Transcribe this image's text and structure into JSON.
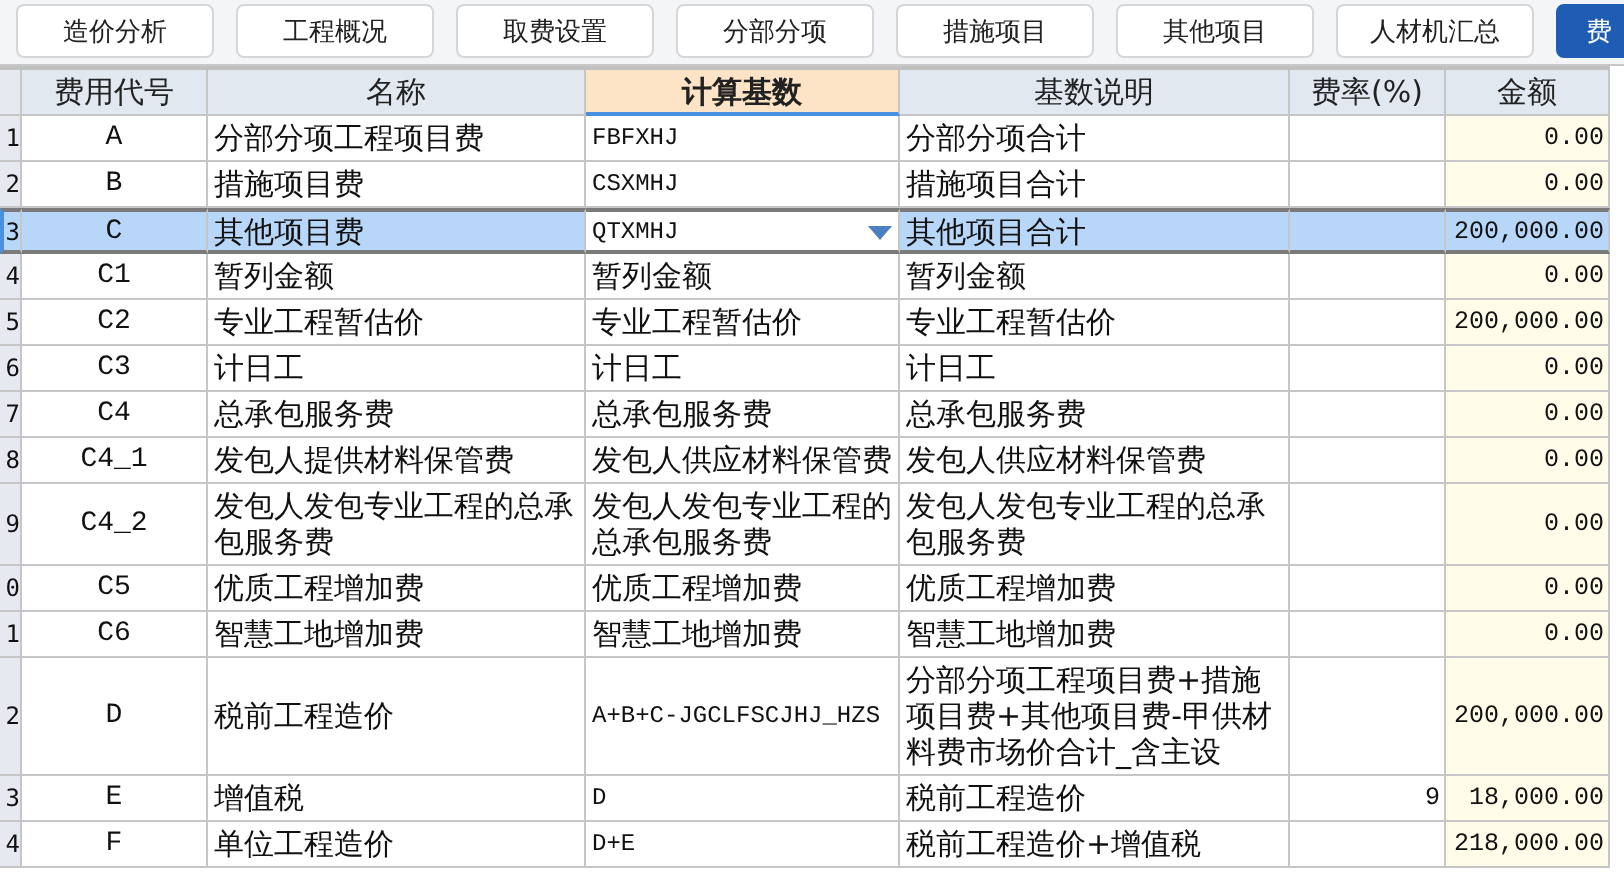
{
  "toolbar": {
    "buttons": [
      {
        "label": "造价分析",
        "selected": false
      },
      {
        "label": "工程概况",
        "selected": false
      },
      {
        "label": "取费设置",
        "selected": false
      },
      {
        "label": "分部分项",
        "selected": false
      },
      {
        "label": "措施项目",
        "selected": false
      },
      {
        "label": "其他项目",
        "selected": false
      },
      {
        "label": "人材机汇总",
        "selected": false
      },
      {
        "label": "费",
        "selected": true
      }
    ]
  },
  "table": {
    "columns": [
      {
        "label": "费用代号",
        "highlighted": false
      },
      {
        "label": "名称",
        "highlighted": false
      },
      {
        "label": "计算基数",
        "highlighted": true
      },
      {
        "label": "基数说明",
        "highlighted": false
      },
      {
        "label": "费率(%)",
        "highlighted": false
      },
      {
        "label": "金额",
        "highlighted": false
      }
    ],
    "rows": [
      {
        "row_number": "1",
        "code": "A",
        "name": "分部分项工程项目费",
        "basis": "FBFXHJ",
        "description": "分部分项合计",
        "amount": "0.00",
        "selected": false
      },
      {
        "row_number": "2",
        "code": "B",
        "name": "措施项目费",
        "basis": "CSXMHJ",
        "description": "措施项目合计",
        "amount": "0.00",
        "selected": false
      },
      {
        "row_number": "3",
        "code": "C",
        "name": "其他项目费",
        "basis": "QTXMHJ",
        "description": "其他项目合计",
        "amount": "200,000.00",
        "selected": true
      },
      {
        "row_number": "4",
        "code": "C1",
        "name": "暂列金额",
        "basis": "暂列金额",
        "description": "暂列金额",
        "amount": "0.00",
        "selected": false
      },
      {
        "row_number": "5",
        "code": "C2",
        "name": "专业工程暂估价",
        "basis": "专业工程暂估价",
        "description": "专业工程暂估价",
        "amount": "200,000.00",
        "selected": false
      },
      {
        "row_number": "6",
        "code": "C3",
        "name": "计日工",
        "basis": "计日工",
        "description": "计日工",
        "amount": "0.00",
        "selected": false
      },
      {
        "row_number": "7",
        "code": "C4",
        "name": "总承包服务费",
        "basis": "总承包服务费",
        "description": "总承包服务费",
        "amount": "0.00",
        "selected": false
      },
      {
        "row_number": "8",
        "code": "C4_1",
        "name": "发包人提供材料保管费",
        "basis": "发包人供应材料保管费",
        "description": "发包人供应材料保管费",
        "amount": "0.00",
        "selected": false
      },
      {
        "row_number": "9",
        "code": "C4_2",
        "name": "发包人发包专业工程的总承包服务费",
        "basis": "发包人发包专业工程的总承包服务费",
        "description": "发包人发包专业工程的总承包服务费",
        "amount": "0.00",
        "selected": false
      },
      {
        "row_number": "0",
        "code": "C5",
        "name": "优质工程增加费",
        "basis": "优质工程增加费",
        "description": "优质工程增加费",
        "amount": "0.00",
        "selected": false
      },
      {
        "row_number": "1",
        "code": "C6",
        "name": "智慧工地增加费",
        "basis": "智慧工地增加费",
        "description": "智慧工地增加费",
        "amount": "0.00",
        "selected": false
      },
      {
        "row_number": "2",
        "code": "D",
        "name": "税前工程造价",
        "basis": "A+B+C-JGCLFSCJHJ_HZS",
        "description": "分部分项工程项目费+措施项目费+其他项目费-甲供材料费市场价合计_含主设",
        "amount": "200,000.00",
        "selected": false
      },
      {
        "row_number": "3",
        "code": "E",
        "name": "增值税",
        "basis": "D",
        "description": "税前工程造价",
        "rate": "9",
        "amount": "18,000.00",
        "selected": false
      },
      {
        "row_number": "4",
        "code": "F",
        "name": "单位工程造价",
        "basis": "D+E",
        "description": "税前工程造价+增值税",
        "amount": "218,000.00",
        "selected": false
      }
    ]
  }
}
